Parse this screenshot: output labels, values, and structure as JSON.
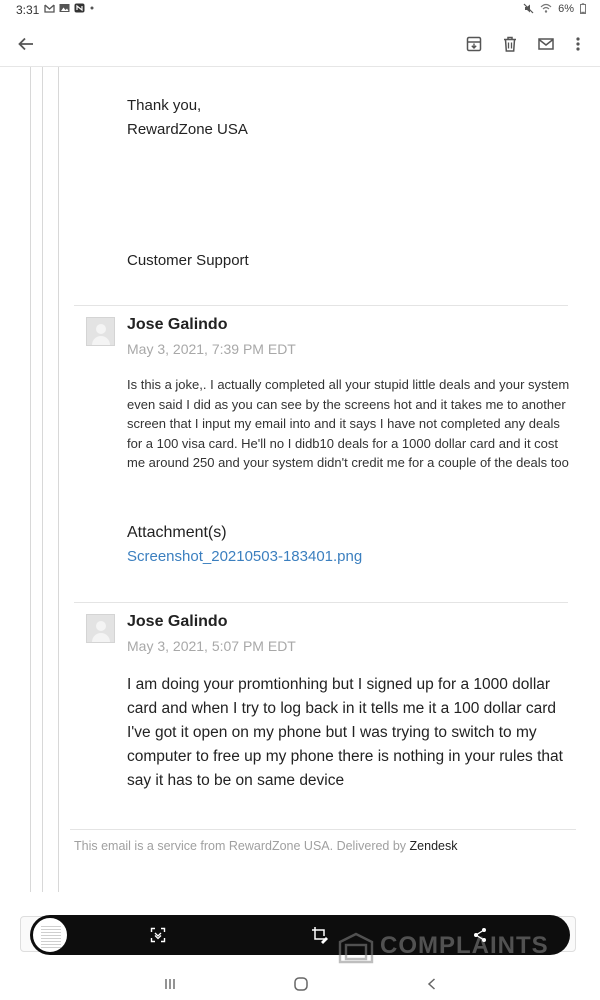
{
  "status_bar": {
    "time": "3:31",
    "battery": "6%",
    "left_icons": [
      "gmail-icon",
      "gallery-icon",
      "app-icon",
      "dot-icon"
    ],
    "right_icons": [
      "mute-icon",
      "wifi-icon",
      "battery-icon"
    ]
  },
  "toolbar": {
    "icons": [
      "back-arrow-icon",
      "archive-icon",
      "trash-icon",
      "mail-icon",
      "more-vert-icon"
    ]
  },
  "signature": {
    "thanks": "Thank you,",
    "company": "RewardZone USA",
    "team": "Customer Support"
  },
  "messages": [
    {
      "author": "Jose Galindo",
      "date": "May 3, 2021, 7:39 PM EDT",
      "body": "Is this a joke,. I actually completed all your stupid little deals and your system even said I did as you can see by the screens hot and it takes me to another screen that I input my email into and it says I have not completed any deals for a 100 visa card. He'll no I didb10 deals for a 1000 dollar card  and it cost me around 250 and your system didn't credit me for a couple of the deals too",
      "attachment_label": "Attachment(s)",
      "attachment_file": "Screenshot_20210503-183401.png"
    },
    {
      "author": "Jose Galindo",
      "date": "May 3, 2021, 5:07 PM EDT",
      "body": "I am doing your promtionhing but I signed up for a 1000 dollar card and when I try to log back in it tells me it a 100 dollar card I've got it open on my phone but I was trying to switch to my computer to free up my phone there is nothing in your rules that say it has to be on same device"
    }
  ],
  "footer": {
    "text": "This email is a service from RewardZone USA. Delivered by ",
    "link": "Zendesk"
  },
  "capture_bar": {
    "icons": [
      "screenshot-thumbnail",
      "scroll-capture-icon",
      "crop-edit-icon",
      "share-icon"
    ]
  },
  "watermark": {
    "text": "COMPLAINTS"
  },
  "nav_bar": {
    "icons": [
      "recents-icon",
      "home-icon",
      "back-icon"
    ]
  },
  "colors": {
    "link": "#3b7fbf",
    "muted": "#a8a8a8",
    "capture_bar": "#0d0d0d"
  }
}
